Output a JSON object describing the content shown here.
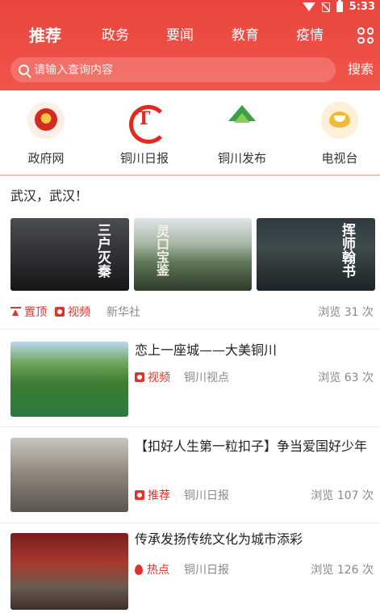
{
  "status": {
    "time": "5:33"
  },
  "tabs": [
    "推荐",
    "政务",
    "要闻",
    "教育",
    "疫情"
  ],
  "search": {
    "placeholder": "请输入查询内容",
    "button": "搜索"
  },
  "quick_links": [
    "政府网",
    "铜川日报",
    "铜川发布",
    "电视台"
  ],
  "feed": {
    "card1": {
      "title": "武汉，武汉！",
      "image_texts": [
        "三户灭秦",
        "灵口宝鉴",
        "挥师翰书"
      ],
      "tag1": "置顶",
      "tag2": "视频",
      "source": "新华社",
      "views": "浏览 31 次"
    },
    "card2": {
      "title": "恋上一座城——大美铜川",
      "tag": "视频",
      "source": "铜川视点",
      "views": "浏览 63 次"
    },
    "card3": {
      "title": "【扣好人生第一粒扣子】争当爱国好少年",
      "tag": "推荐",
      "source": "铜川日报",
      "views": "浏览 107 次"
    },
    "card4": {
      "title": "传承发扬传统文化为城市添彩",
      "tag": "热点",
      "source": "铜川日报",
      "views": "浏览 126 次"
    }
  },
  "colors": {
    "brand": "#e8453e",
    "tag": "#e0332a"
  }
}
